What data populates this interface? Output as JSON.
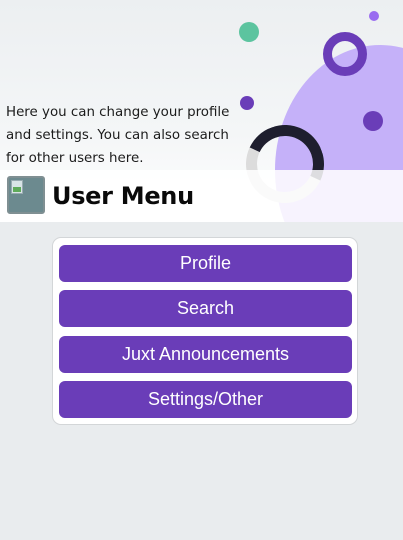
{
  "header": {
    "description": "Here you can change your profile and settings. You can also search for other users here.",
    "title": "User Menu",
    "avatar_icon": "broken-image-icon"
  },
  "menu": {
    "items": [
      {
        "label": "Profile"
      },
      {
        "label": "Search"
      },
      {
        "label": "Juxt Announcements"
      },
      {
        "label": "Settings/Other"
      }
    ]
  },
  "colors": {
    "accent": "#6a3db8",
    "background": "#e9ecee",
    "decor_lavender": "#c5b1f9",
    "decor_green": "#5cc49f",
    "decor_dark": "#1e1e2e"
  }
}
